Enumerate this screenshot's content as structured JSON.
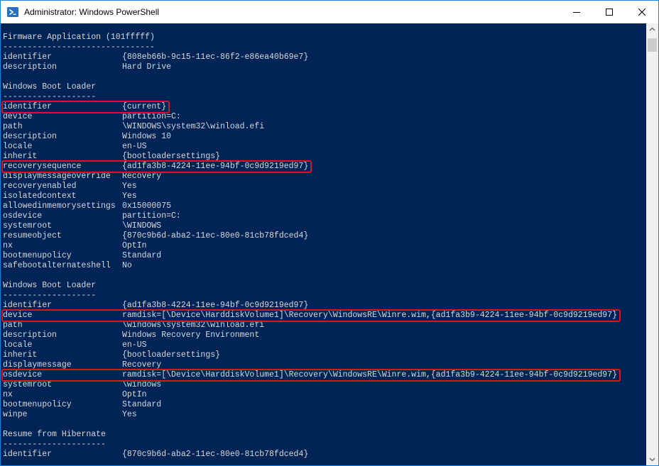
{
  "window": {
    "title": "Administrator: Windows PowerShell",
    "icon": "powershell-icon"
  },
  "controls": {
    "minimize": "minimize-icon",
    "maximize": "maximize-icon",
    "close": "close-icon"
  },
  "colors": {
    "console_bg": "#012456",
    "console_text": "#d8d8d8",
    "highlight": "#e0131d"
  },
  "console": {
    "lines": [
      {
        "text": "Firmware Application (101fffff)"
      },
      {
        "text": "-------------------------------"
      },
      {
        "key": "identifier",
        "value": "{808eb66b-9c15-11ec-86f2-e86ea40b69e7}"
      },
      {
        "key": "description",
        "value": "Hard Drive"
      },
      {
        "text": ""
      },
      {
        "text": "Windows Boot Loader"
      },
      {
        "text": "-------------------"
      },
      {
        "key": "identifier",
        "value": "{current}",
        "highlight": true
      },
      {
        "key": "device",
        "value": "partition=C:"
      },
      {
        "key": "path",
        "value": "\\WINDOWS\\system32\\winload.efi"
      },
      {
        "key": "description",
        "value": "Windows 10"
      },
      {
        "key": "locale",
        "value": "en-US"
      },
      {
        "key": "inherit",
        "value": "{bootloadersettings}"
      },
      {
        "key": "recoverysequence",
        "value": "{ad1fa3b8-4224-11ee-94bf-0c9d9219ed97}",
        "highlight": true
      },
      {
        "key": "displaymessageoverride",
        "value": "Recovery"
      },
      {
        "key": "recoveryenabled",
        "value": "Yes"
      },
      {
        "key": "isolatedcontext",
        "value": "Yes"
      },
      {
        "key": "allowedinmemorysettings",
        "value": "0x15000075"
      },
      {
        "key": "osdevice",
        "value": "partition=C:"
      },
      {
        "key": "systemroot",
        "value": "\\WINDOWS"
      },
      {
        "key": "resumeobject",
        "value": "{870c9b6d-aba2-11ec-80e0-81cb78fdced4}"
      },
      {
        "key": "nx",
        "value": "OptIn"
      },
      {
        "key": "bootmenupolicy",
        "value": "Standard"
      },
      {
        "key": "safebootalternateshell",
        "value": "No"
      },
      {
        "text": ""
      },
      {
        "text": "Windows Boot Loader"
      },
      {
        "text": "-------------------"
      },
      {
        "key": "identifier",
        "value": "{ad1fa3b8-4224-11ee-94bf-0c9d9219ed97}"
      },
      {
        "key": "device",
        "value": "ramdisk=[\\Device\\HarddiskVolume1]\\Recovery\\WindowsRE\\Winre.wim,{ad1fa3b9-4224-11ee-94bf-0c9d9219ed97}",
        "highlight": true
      },
      {
        "key": "path",
        "value": "\\windows\\system32\\winload.efi"
      },
      {
        "key": "description",
        "value": "Windows Recovery Environment"
      },
      {
        "key": "locale",
        "value": "en-US"
      },
      {
        "key": "inherit",
        "value": "{bootloadersettings}"
      },
      {
        "key": "displaymessage",
        "value": "Recovery"
      },
      {
        "key": "osdevice",
        "value": "ramdisk=[\\Device\\HarddiskVolume1]\\Recovery\\WindowsRE\\Winre.wim,{ad1fa3b9-4224-11ee-94bf-0c9d9219ed97}",
        "highlight": true
      },
      {
        "key": "systemroot",
        "value": "\\windows"
      },
      {
        "key": "nx",
        "value": "OptIn"
      },
      {
        "key": "bootmenupolicy",
        "value": "Standard"
      },
      {
        "key": "winpe",
        "value": "Yes"
      },
      {
        "text": ""
      },
      {
        "text": "Resume from Hibernate"
      },
      {
        "text": "---------------------"
      },
      {
        "key": "identifier",
        "value": "{870c9b6d-aba2-11ec-80e0-81cb78fdced4}"
      }
    ]
  }
}
